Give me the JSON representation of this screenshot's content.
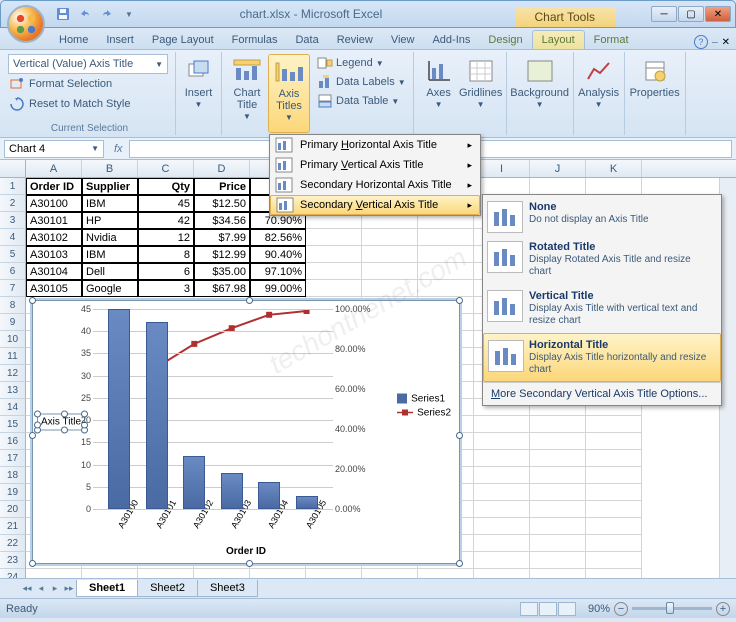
{
  "app": {
    "title": "chart.xlsx - Microsoft Excel",
    "contextual_title": "Chart Tools"
  },
  "qat": {
    "save": "Save",
    "undo": "Undo",
    "redo": "Redo"
  },
  "tabs": [
    "Home",
    "Insert",
    "Page Layout",
    "Formulas",
    "Data",
    "Review",
    "View",
    "Add-Ins"
  ],
  "ctx_tabs": [
    "Design",
    "Layout",
    "Format"
  ],
  "active_ctx_tab": "Layout",
  "ribbon": {
    "current_selection": {
      "combo": "Vertical (Value) Axis Title",
      "format_selection": "Format Selection",
      "reset": "Reset to Match Style",
      "label": "Current Selection"
    },
    "insert": "Insert",
    "chart_title": "Chart Title",
    "axis_titles": "Axis Titles",
    "legend": "Legend",
    "data_labels": "Data Labels",
    "data_table": "Data Table",
    "axes": "Axes",
    "gridlines": "Gridlines",
    "background": "Background",
    "analysis": "Analysis",
    "properties": "Properties"
  },
  "namebox": "Chart 4",
  "table": {
    "headers": [
      "Order ID",
      "Supplier",
      "Qty",
      "Price",
      ""
    ],
    "rows": [
      [
        "A30100",
        "IBM",
        "45",
        "$12.50",
        ""
      ],
      [
        "A30101",
        "HP",
        "42",
        "$34.56",
        "70.90%"
      ],
      [
        "A30102",
        "Nvidia",
        "12",
        "$7.99",
        "82.56%"
      ],
      [
        "A30103",
        "IBM",
        "8",
        "$12.99",
        "90.40%"
      ],
      [
        "A30104",
        "Dell",
        "6",
        "$35.00",
        "97.10%"
      ],
      [
        "A30105",
        "Google",
        "3",
        "$67.98",
        "99.00%"
      ]
    ]
  },
  "chart_data": {
    "type": "bar",
    "categories": [
      "A30100",
      "A30101",
      "A30102",
      "A30103",
      "A30104",
      "A30105"
    ],
    "series": [
      {
        "name": "Series1",
        "type": "bar",
        "values": [
          45,
          42,
          12,
          8,
          6,
          3
        ]
      },
      {
        "name": "Series2",
        "type": "line",
        "values": [
          null,
          70.9,
          82.56,
          90.4,
          97.1,
          99.0
        ]
      }
    ],
    "ylabel_placeholder": "Axis Title",
    "xlabel": "Order ID",
    "ylim": [
      0,
      45
    ],
    "yticks": [
      0,
      5,
      10,
      15,
      20,
      25,
      30,
      35,
      40,
      45
    ],
    "y2lim": [
      0,
      100
    ],
    "y2ticks": [
      "0.00%",
      "20.00%",
      "40.00%",
      "60.00%",
      "80.00%",
      "100.00%"
    ]
  },
  "axis_menu": {
    "items": [
      "Primary Horizontal Axis Title",
      "Primary Vertical Axis Title",
      "Secondary Horizontal Axis Title",
      "Secondary Vertical Axis Title"
    ],
    "hover_index": 3
  },
  "gallery": {
    "items": [
      {
        "title": "None",
        "desc": "Do not display an Axis Title"
      },
      {
        "title": "Rotated Title",
        "desc": "Display Rotated Axis Title and resize chart"
      },
      {
        "title": "Vertical Title",
        "desc": "Display Axis Title with vertical text and resize chart"
      },
      {
        "title": "Horizontal Title",
        "desc": "Display Axis Title horizontally and resize chart"
      }
    ],
    "hover_index": 3,
    "footer": "More Secondary Vertical Axis Title Options..."
  },
  "sheets": [
    "Sheet1",
    "Sheet2",
    "Sheet3"
  ],
  "active_sheet": 0,
  "status": "Ready",
  "zoom": "90%",
  "columns": [
    "A",
    "B",
    "C",
    "D",
    "E",
    "F",
    "G",
    "H",
    "I",
    "J",
    "K"
  ]
}
